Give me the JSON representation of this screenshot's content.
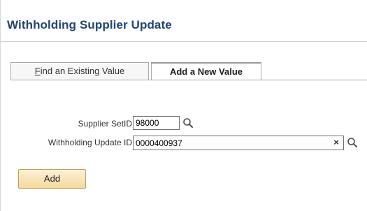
{
  "page": {
    "title": "Withholding Supplier Update"
  },
  "tabs": [
    {
      "label_first": "F",
      "label_rest": "ind an Existing Value",
      "selected": false
    },
    {
      "label": "Add a New Value",
      "selected": true
    }
  ],
  "form": {
    "setid": {
      "label": "Supplier SetID",
      "value": "98000",
      "icon": "magnifier-icon"
    },
    "update_id": {
      "label": "Withholding Update ID",
      "value": "0000400937",
      "clear_glyph": "×",
      "icon": "magnifier-icon"
    }
  },
  "actions": {
    "add_label": "Add"
  },
  "colors": {
    "title": "#23456f",
    "button_top": "#fdf1d7",
    "button_bottom": "#f4d99c",
    "button_border": "#c0a060"
  }
}
